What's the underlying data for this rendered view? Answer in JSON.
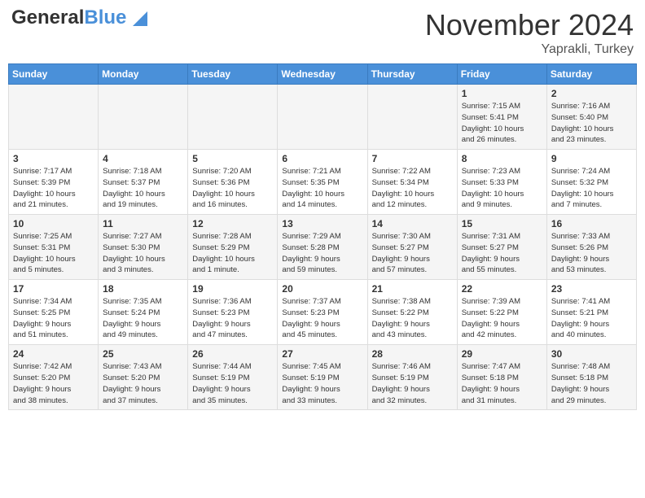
{
  "header": {
    "logo_line1": "General",
    "logo_line2": "Blue",
    "month": "November 2024",
    "location": "Yaprakli, Turkey"
  },
  "days_of_week": [
    "Sunday",
    "Monday",
    "Tuesday",
    "Wednesday",
    "Thursday",
    "Friday",
    "Saturday"
  ],
  "weeks": [
    [
      {
        "day": "",
        "info": ""
      },
      {
        "day": "",
        "info": ""
      },
      {
        "day": "",
        "info": ""
      },
      {
        "day": "",
        "info": ""
      },
      {
        "day": "",
        "info": ""
      },
      {
        "day": "1",
        "info": "Sunrise: 7:15 AM\nSunset: 5:41 PM\nDaylight: 10 hours\nand 26 minutes."
      },
      {
        "day": "2",
        "info": "Sunrise: 7:16 AM\nSunset: 5:40 PM\nDaylight: 10 hours\nand 23 minutes."
      }
    ],
    [
      {
        "day": "3",
        "info": "Sunrise: 7:17 AM\nSunset: 5:39 PM\nDaylight: 10 hours\nand 21 minutes."
      },
      {
        "day": "4",
        "info": "Sunrise: 7:18 AM\nSunset: 5:37 PM\nDaylight: 10 hours\nand 19 minutes."
      },
      {
        "day": "5",
        "info": "Sunrise: 7:20 AM\nSunset: 5:36 PM\nDaylight: 10 hours\nand 16 minutes."
      },
      {
        "day": "6",
        "info": "Sunrise: 7:21 AM\nSunset: 5:35 PM\nDaylight: 10 hours\nand 14 minutes."
      },
      {
        "day": "7",
        "info": "Sunrise: 7:22 AM\nSunset: 5:34 PM\nDaylight: 10 hours\nand 12 minutes."
      },
      {
        "day": "8",
        "info": "Sunrise: 7:23 AM\nSunset: 5:33 PM\nDaylight: 10 hours\nand 9 minutes."
      },
      {
        "day": "9",
        "info": "Sunrise: 7:24 AM\nSunset: 5:32 PM\nDaylight: 10 hours\nand 7 minutes."
      }
    ],
    [
      {
        "day": "10",
        "info": "Sunrise: 7:25 AM\nSunset: 5:31 PM\nDaylight: 10 hours\nand 5 minutes."
      },
      {
        "day": "11",
        "info": "Sunrise: 7:27 AM\nSunset: 5:30 PM\nDaylight: 10 hours\nand 3 minutes."
      },
      {
        "day": "12",
        "info": "Sunrise: 7:28 AM\nSunset: 5:29 PM\nDaylight: 10 hours\nand 1 minute."
      },
      {
        "day": "13",
        "info": "Sunrise: 7:29 AM\nSunset: 5:28 PM\nDaylight: 9 hours\nand 59 minutes."
      },
      {
        "day": "14",
        "info": "Sunrise: 7:30 AM\nSunset: 5:27 PM\nDaylight: 9 hours\nand 57 minutes."
      },
      {
        "day": "15",
        "info": "Sunrise: 7:31 AM\nSunset: 5:27 PM\nDaylight: 9 hours\nand 55 minutes."
      },
      {
        "day": "16",
        "info": "Sunrise: 7:33 AM\nSunset: 5:26 PM\nDaylight: 9 hours\nand 53 minutes."
      }
    ],
    [
      {
        "day": "17",
        "info": "Sunrise: 7:34 AM\nSunset: 5:25 PM\nDaylight: 9 hours\nand 51 minutes."
      },
      {
        "day": "18",
        "info": "Sunrise: 7:35 AM\nSunset: 5:24 PM\nDaylight: 9 hours\nand 49 minutes."
      },
      {
        "day": "19",
        "info": "Sunrise: 7:36 AM\nSunset: 5:23 PM\nDaylight: 9 hours\nand 47 minutes."
      },
      {
        "day": "20",
        "info": "Sunrise: 7:37 AM\nSunset: 5:23 PM\nDaylight: 9 hours\nand 45 minutes."
      },
      {
        "day": "21",
        "info": "Sunrise: 7:38 AM\nSunset: 5:22 PM\nDaylight: 9 hours\nand 43 minutes."
      },
      {
        "day": "22",
        "info": "Sunrise: 7:39 AM\nSunset: 5:22 PM\nDaylight: 9 hours\nand 42 minutes."
      },
      {
        "day": "23",
        "info": "Sunrise: 7:41 AM\nSunset: 5:21 PM\nDaylight: 9 hours\nand 40 minutes."
      }
    ],
    [
      {
        "day": "24",
        "info": "Sunrise: 7:42 AM\nSunset: 5:20 PM\nDaylight: 9 hours\nand 38 minutes."
      },
      {
        "day": "25",
        "info": "Sunrise: 7:43 AM\nSunset: 5:20 PM\nDaylight: 9 hours\nand 37 minutes."
      },
      {
        "day": "26",
        "info": "Sunrise: 7:44 AM\nSunset: 5:19 PM\nDaylight: 9 hours\nand 35 minutes."
      },
      {
        "day": "27",
        "info": "Sunrise: 7:45 AM\nSunset: 5:19 PM\nDaylight: 9 hours\nand 33 minutes."
      },
      {
        "day": "28",
        "info": "Sunrise: 7:46 AM\nSunset: 5:19 PM\nDaylight: 9 hours\nand 32 minutes."
      },
      {
        "day": "29",
        "info": "Sunrise: 7:47 AM\nSunset: 5:18 PM\nDaylight: 9 hours\nand 31 minutes."
      },
      {
        "day": "30",
        "info": "Sunrise: 7:48 AM\nSunset: 5:18 PM\nDaylight: 9 hours\nand 29 minutes."
      }
    ]
  ]
}
